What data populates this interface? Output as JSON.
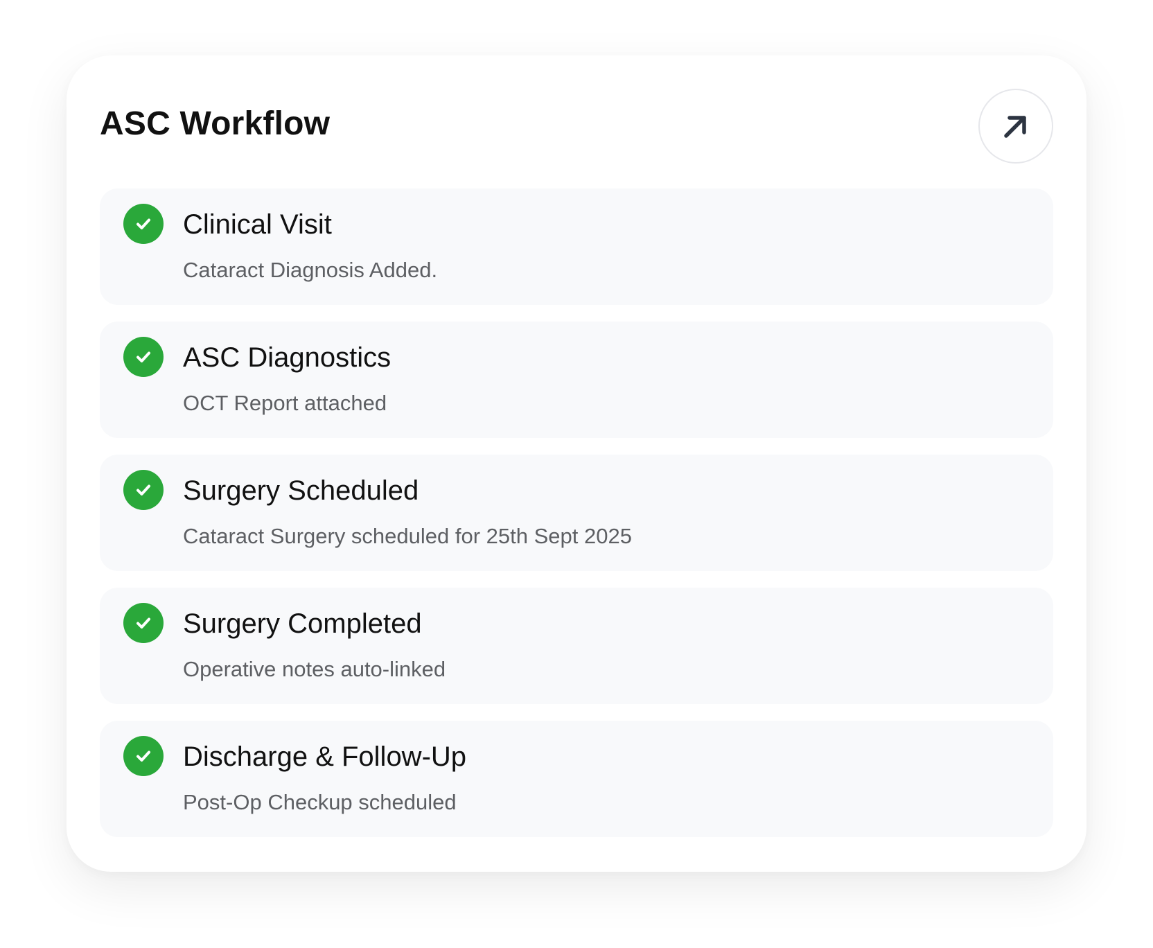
{
  "card": {
    "title": "ASC Workflow",
    "expand_icon": "arrow-up-right-icon"
  },
  "status_color": "#2aa83a",
  "steps": [
    {
      "title": "Clinical Visit",
      "description": "Cataract Diagnosis Added.",
      "status": "completed",
      "icon": "check-circle-icon"
    },
    {
      "title": "ASC Diagnostics",
      "description": "OCT Report attached",
      "status": "completed",
      "icon": "check-circle-icon"
    },
    {
      "title": "Surgery Scheduled",
      "description": "Cataract Surgery scheduled for 25th Sept 2025",
      "status": "completed",
      "icon": "check-circle-icon"
    },
    {
      "title": "Surgery Completed",
      "description": "Operative notes auto-linked",
      "status": "completed",
      "icon": "check-circle-icon"
    },
    {
      "title": "Discharge & Follow-Up",
      "description": "Post-Op Checkup scheduled",
      "status": "completed",
      "icon": "check-circle-icon"
    }
  ]
}
